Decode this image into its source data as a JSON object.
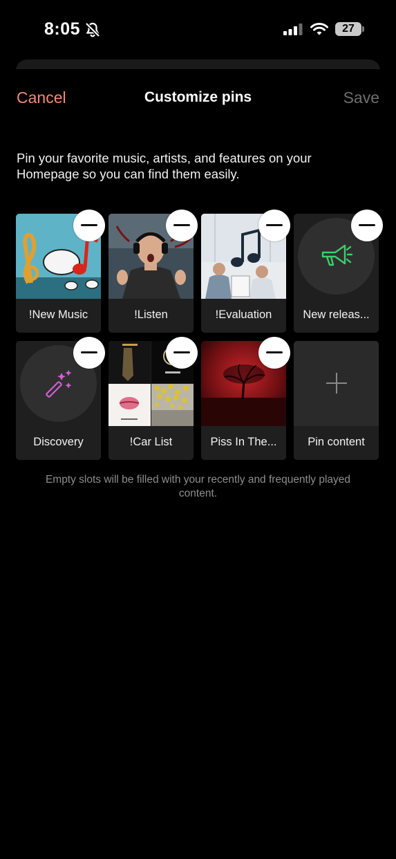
{
  "status_bar": {
    "time": "8:05",
    "battery": "27"
  },
  "header": {
    "cancel_label": "Cancel",
    "title": "Customize pins",
    "save_label": "Save"
  },
  "description": "Pin your favorite music, artists, and features on your Homepage so you can find them easily.",
  "pins": [
    {
      "label": "!New Music",
      "removable": true
    },
    {
      "label": "!Listen",
      "removable": true
    },
    {
      "label": "!Evaluation",
      "removable": true
    },
    {
      "label": "New releas...",
      "removable": true
    },
    {
      "label": "Discovery",
      "removable": true
    },
    {
      "label": "!Car List",
      "removable": true
    },
    {
      "label": "Piss In The...",
      "removable": true
    },
    {
      "label": "Pin content",
      "removable": false
    }
  ],
  "footnote": "Empty slots will be filled with your recently and frequently played content.",
  "colors": {
    "accent": "#f08c72",
    "disabled": "#6e6e6e",
    "megaphone": "#3ccf6e",
    "wand": "#d35fd6"
  }
}
